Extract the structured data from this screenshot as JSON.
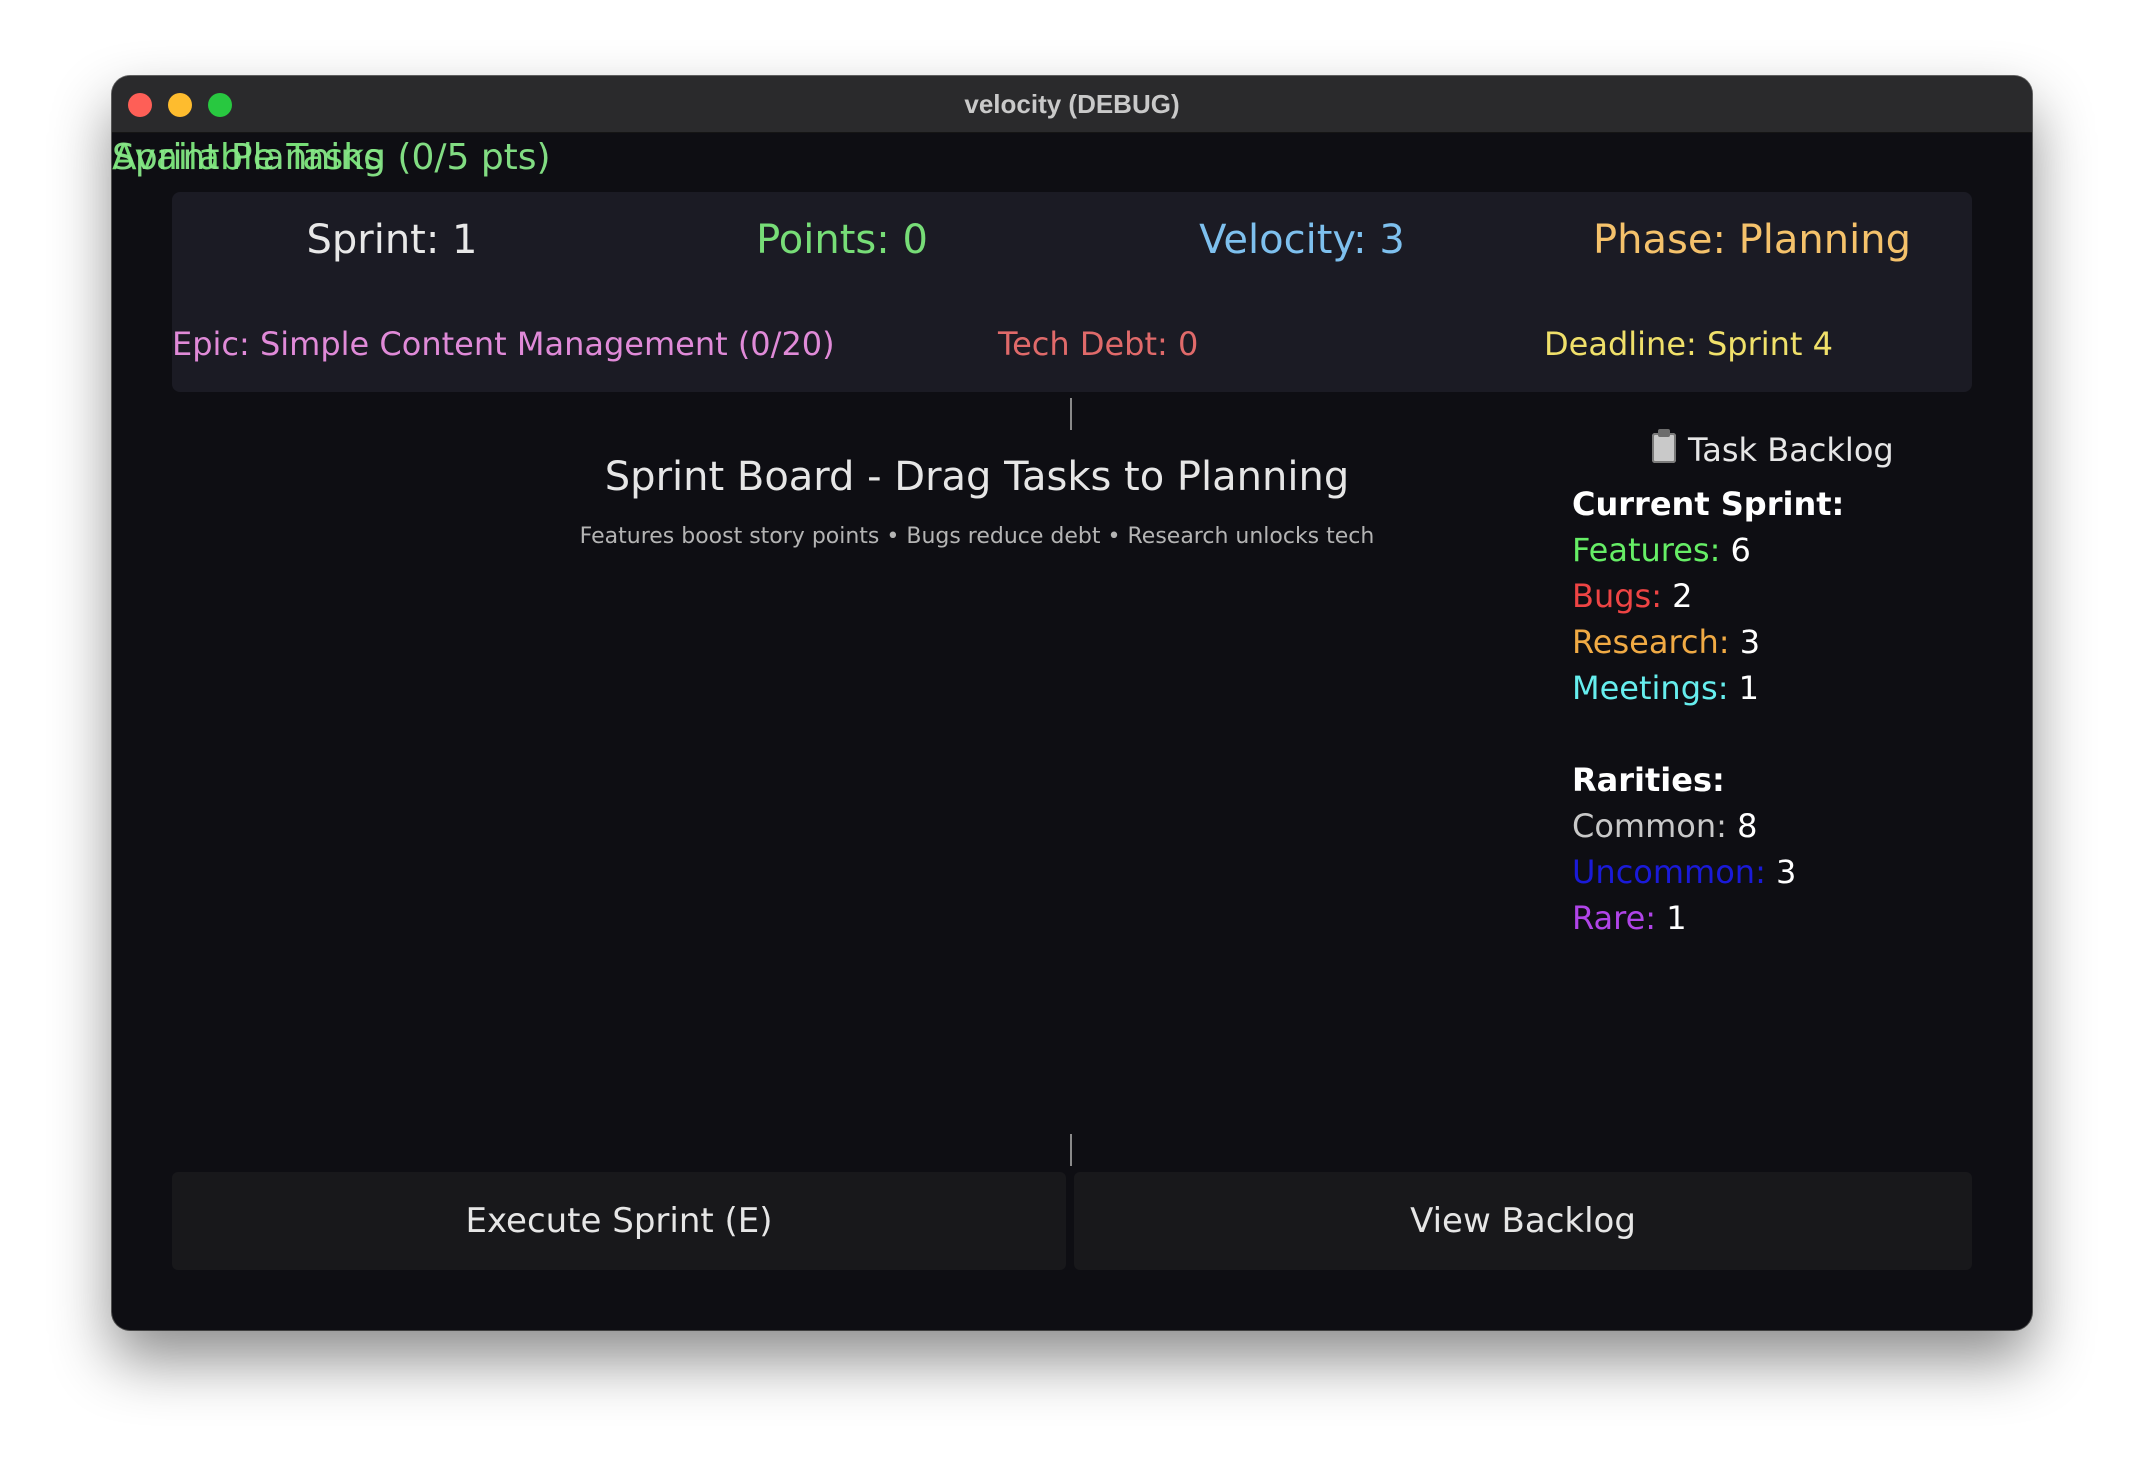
{
  "window": {
    "title": "velocity (DEBUG)"
  },
  "overlay": {
    "line1": "Available Tasks",
    "line2": "Sprint Planning (0/5 pts)"
  },
  "stats": {
    "sprint": "Sprint: 1",
    "points": "Points: 0",
    "velocity": "Velocity: 3",
    "phase": "Phase: Planning",
    "epic": "Epic: Simple Content Management (0/20)",
    "tech_debt": "Tech Debt: 0",
    "deadline": "Deadline: Sprint 4"
  },
  "board": {
    "title": "Sprint Board - Drag Tasks to Planning",
    "subtitle": "Features boost story points • Bugs reduce debt • Research unlocks tech"
  },
  "backlog": {
    "header": "Task Backlog",
    "header_icon": "clipboard-icon",
    "current_sprint_heading": "Current Sprint:",
    "categories": [
      {
        "label": "Features:",
        "value": "6",
        "color": "#66ee66"
      },
      {
        "label": "Bugs:",
        "value": "2",
        "color": "#ee4444"
      },
      {
        "label": "Research:",
        "value": "3",
        "color": "#f0aa44"
      },
      {
        "label": "Meetings:",
        "value": "1",
        "color": "#66eeee"
      }
    ],
    "rarities_heading": "Rarities:",
    "rarities": [
      {
        "label": "Common:",
        "value": "8",
        "color": "#c8c8c8"
      },
      {
        "label": "Uncommon:",
        "value": "3",
        "color": "#1a1ad8"
      },
      {
        "label": "Rare:",
        "value": "1",
        "color": "#b044e8"
      }
    ]
  },
  "buttons": {
    "execute": "Execute Sprint (E)",
    "backlog": "View Backlog"
  }
}
